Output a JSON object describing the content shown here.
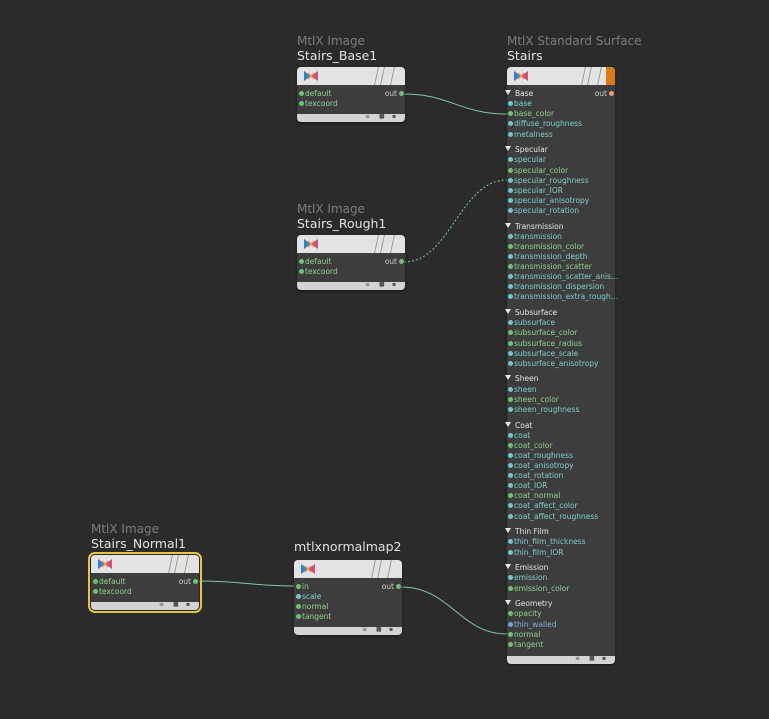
{
  "nodes": {
    "base1": {
      "type_label": "MtlX Image",
      "name": "Stairs_Base1",
      "inputs": [
        "default",
        "texcoord"
      ],
      "output": "out",
      "footer": [
        "≡",
        "■",
        "▪"
      ]
    },
    "rough1": {
      "type_label": "MtlX Image",
      "name": "Stairs_Rough1",
      "inputs": [
        "default",
        "texcoord"
      ],
      "output": "out",
      "footer": [
        "≡",
        "■",
        "▪"
      ]
    },
    "normal1": {
      "type_label": "MtlX Image",
      "name": "Stairs_Normal1",
      "inputs": [
        "default",
        "texcoord"
      ],
      "output": "out",
      "footer": [
        "≡",
        "■",
        "▪"
      ]
    },
    "normalmap": {
      "name": "mtlxnormalmap2",
      "inputs": [
        "in",
        "scale",
        "normal",
        "tangent"
      ],
      "output": "out",
      "footer": [
        "≡",
        "■",
        "▪"
      ]
    },
    "surface": {
      "type_label": "MtlX Standard Surface",
      "name": "Stairs",
      "output": "out",
      "footer": [
        "≡",
        "■",
        "▪"
      ],
      "sections": [
        {
          "title": "Base",
          "ports": [
            {
              "label": "base",
              "color": "teal"
            },
            {
              "label": "base_color",
              "color": "green"
            },
            {
              "label": "diffuse_roughness",
              "color": "teal"
            },
            {
              "label": "metalness",
              "color": "teal"
            }
          ]
        },
        {
          "title": "Specular",
          "ports": [
            {
              "label": "specular",
              "color": "teal"
            },
            {
              "label": "specular_color",
              "color": "green"
            },
            {
              "label": "specular_roughness",
              "color": "teal"
            },
            {
              "label": "specular_IOR",
              "color": "teal"
            },
            {
              "label": "specular_anisotropy",
              "color": "teal"
            },
            {
              "label": "specular_rotation",
              "color": "teal"
            }
          ]
        },
        {
          "title": "Transmission",
          "ports": [
            {
              "label": "transmission",
              "color": "teal"
            },
            {
              "label": "transmission_color",
              "color": "green"
            },
            {
              "label": "transmission_depth",
              "color": "teal"
            },
            {
              "label": "transmission_scatter",
              "color": "green"
            },
            {
              "label": "transmission_scatter_anis…",
              "color": "teal"
            },
            {
              "label": "transmission_dispersion",
              "color": "teal"
            },
            {
              "label": "transmission_extra_rough…",
              "color": "teal"
            }
          ]
        },
        {
          "title": "Subsurface",
          "ports": [
            {
              "label": "subsurface",
              "color": "teal"
            },
            {
              "label": "subsurface_color",
              "color": "green"
            },
            {
              "label": "subsurface_radius",
              "color": "green"
            },
            {
              "label": "subsurface_scale",
              "color": "teal"
            },
            {
              "label": "subsurface_anisotropy",
              "color": "teal"
            }
          ]
        },
        {
          "title": "Sheen",
          "ports": [
            {
              "label": "sheen",
              "color": "teal"
            },
            {
              "label": "sheen_color",
              "color": "green"
            },
            {
              "label": "sheen_roughness",
              "color": "teal"
            }
          ]
        },
        {
          "title": "Coat",
          "ports": [
            {
              "label": "coat",
              "color": "teal"
            },
            {
              "label": "coat_color",
              "color": "green"
            },
            {
              "label": "coat_roughness",
              "color": "teal"
            },
            {
              "label": "coat_anisotropy",
              "color": "teal"
            },
            {
              "label": "coat_rotation",
              "color": "teal"
            },
            {
              "label": "coat_IOR",
              "color": "teal"
            },
            {
              "label": "coat_normal",
              "color": "green"
            },
            {
              "label": "coat_affect_color",
              "color": "teal"
            },
            {
              "label": "coat_affect_roughness",
              "color": "teal"
            }
          ]
        },
        {
          "title": "Thin Film",
          "ports": [
            {
              "label": "thin_film_thickness",
              "color": "teal"
            },
            {
              "label": "thin_film_IOR",
              "color": "teal"
            }
          ]
        },
        {
          "title": "Emission",
          "ports": [
            {
              "label": "emission",
              "color": "teal"
            },
            {
              "label": "emission_color",
              "color": "green"
            }
          ]
        },
        {
          "title": "Geometry",
          "ports": [
            {
              "label": "opacity",
              "color": "green"
            },
            {
              "label": "thin_walled",
              "color": "blue"
            },
            {
              "label": "normal",
              "color": "green"
            },
            {
              "label": "tangent",
              "color": "green"
            }
          ]
        }
      ]
    }
  },
  "colors": {
    "background": "#2b2b2b",
    "node_body": "#3d3d3d",
    "header": "#e3e3e3",
    "selection": "#e7c543",
    "render_flag": "#d97a15",
    "wire": "#7fc9a0"
  }
}
